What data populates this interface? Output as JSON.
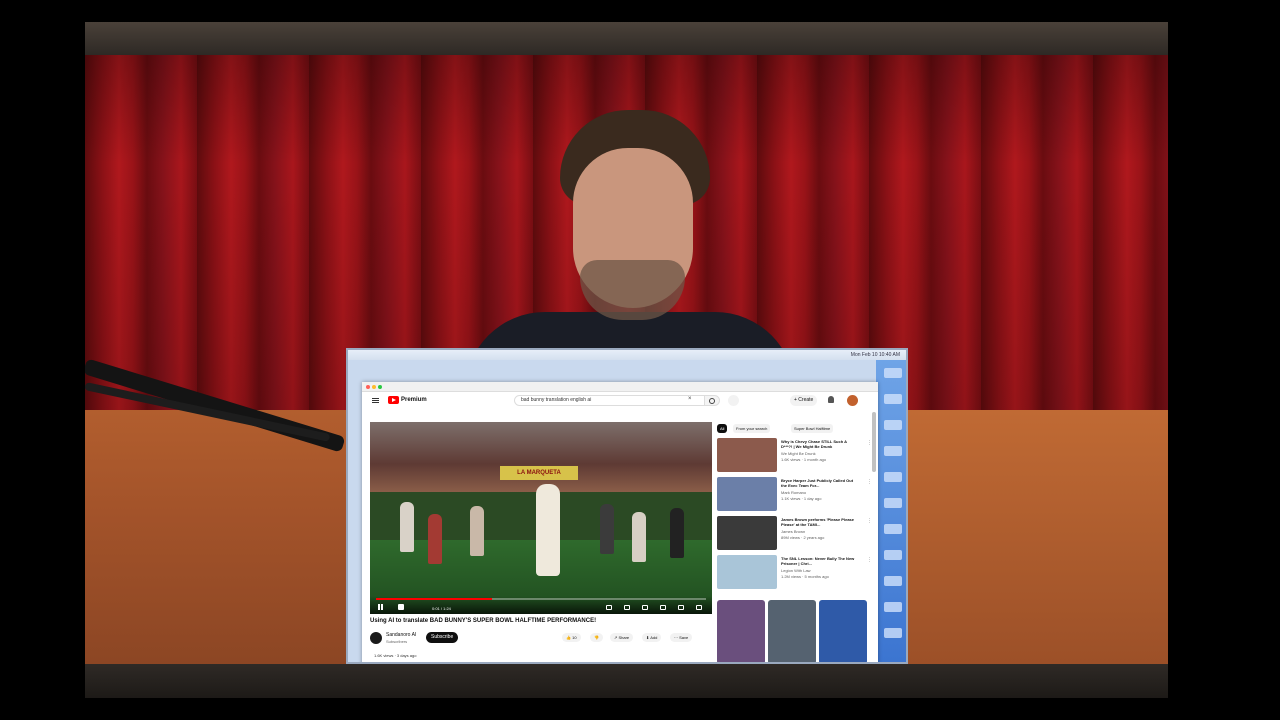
{
  "youtube": {
    "brand": "Premium",
    "search_query": "bad bunny translation english ai",
    "create_label": "+ Create",
    "video": {
      "title": "Using AI to translate BAD BUNNY'S SUPER BOWL HALFTIME PERFORMANCE!",
      "stadium_sign": "LA MARQUETA",
      "time": "0:01 / 1:24",
      "progress": 0.35,
      "channel": "Sandanoro AI",
      "subscribers": "Subscribers",
      "subscribe_label": "Subscribe",
      "actions": [
        "👍 10",
        "👎",
        "↗ Share",
        "⬇ Add",
        "⋯ Save"
      ],
      "meta": "1.6K views · 3 days ago"
    },
    "chips": [
      "All",
      "From your search",
      "Super Bowl Halftime"
    ],
    "recommendations": [
      {
        "title": "Why is Chevy Chase STILL Such A D***?! | We Might Be Drunk",
        "channel": "We Might Be Drunk",
        "meta": "1.6K views · 1 month ago",
        "color": "#8c5a4c"
      },
      {
        "title": "Bryce Harper Just Publicly Called Out the Exec Team For...",
        "channel": "Mark Romano",
        "meta": "1.1K views · 1 day ago",
        "color": "#6b7fa8"
      },
      {
        "title": "James Brown performs 'Please Please Please' at the TAMI...",
        "channel": "James Brown",
        "meta": "89M views · 2 years ago",
        "color": "#3a3a3a"
      },
      {
        "title": "The SNL Lesson: Never Bully The New Prisoner | Chri...",
        "channel": "Legion With Law",
        "meta": "1.2M views · 5 months ago",
        "color": "#a9c5d8"
      }
    ],
    "shorts_colors": [
      "#6a4f7d",
      "#556270",
      "#2f5aa8"
    ]
  },
  "menubar_clock": "Mon Feb 10 10:40 AM"
}
